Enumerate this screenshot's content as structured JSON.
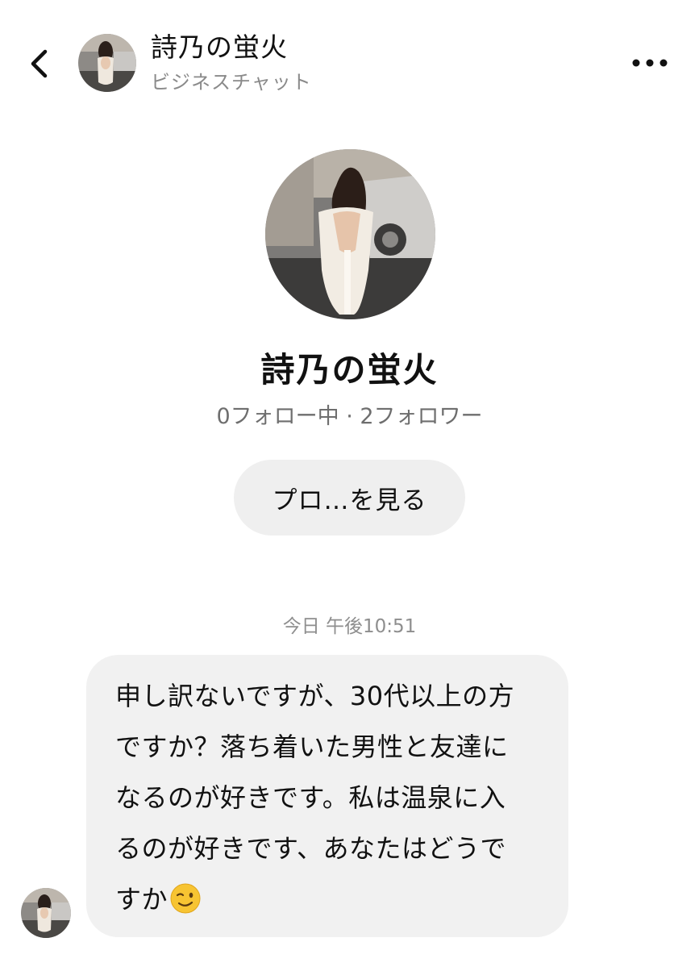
{
  "header": {
    "title": "詩乃の蛍火",
    "subtitle": "ビジネスチャット",
    "back_icon": "chevron-left-icon",
    "more_icon": "more-horizontal-icon"
  },
  "profile": {
    "name": "詩乃の蛍火",
    "stats": "0フォロー中 · 2フォロワー",
    "view_profile_label": "プロ…を見る"
  },
  "chat": {
    "timestamp": "今日 午後10:51",
    "message": {
      "lines": [
        "申し訳ないですが、30代以上の方",
        "ですか？落ち着いた男性と友達に",
        "なるのが好きです。私は温泉に入",
        "るのが好きです、あなたはどうで",
        "すか"
      ],
      "trailing_emoji": "wink-emoji"
    }
  },
  "colors": {
    "background": "#ffffff",
    "bubble": "#f1f1f1",
    "button": "#efefef",
    "secondary_text": "#8a8a8a",
    "primary_text": "#111111"
  }
}
